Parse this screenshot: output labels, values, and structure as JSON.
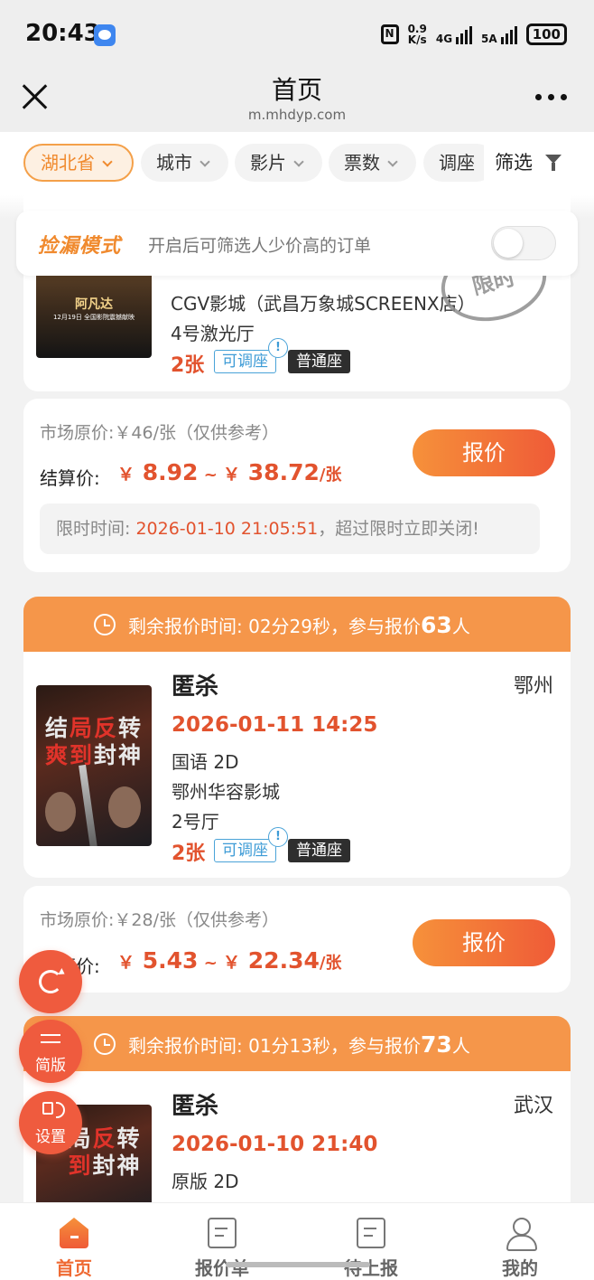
{
  "status_bar": {
    "time": "20:43",
    "nfc": "N",
    "speed_value": "0.9",
    "speed_unit": "K/s",
    "network_1": "4G",
    "network_2": "5A",
    "battery": "100"
  },
  "header": {
    "title": "首页",
    "url": "m.mhdyp.com"
  },
  "filters": {
    "chips": [
      "湖北省",
      "城市",
      "影片",
      "票数",
      "调座"
    ],
    "screen_label": "筛选"
  },
  "pickup_mode": {
    "title": "捡漏模式",
    "description": "开启后可筛选人少价高的订单",
    "enabled": false
  },
  "order_partial": {
    "cinema": "CGV影城（武昌万象城SCREENX店）",
    "hall": "4号激光厅",
    "count": "2张",
    "tag_adjustable": "可调座",
    "tag_seat": "普通座",
    "stamp": "限时",
    "poster_text": "阿凡达",
    "poster_sub": "12月19日 全国影院震撼献映",
    "market_price": "市场原价:￥46/张（仅供参考）",
    "settle_label": "结算价:",
    "price_low": "8.92",
    "price_high": "38.72",
    "currency": "￥",
    "unit": "/张",
    "quote_button": "报价",
    "limit_label": "限时时间:",
    "limit_time": "2026-01-10 21:05:51",
    "limit_note": "，超过限时立即关闭!"
  },
  "orders": [
    {
      "countdown_prefix": "剩余报价时间:",
      "countdown": "02分29秒",
      "participants_prefix": "，参与报价",
      "participants": "63",
      "participants_suffix": "人",
      "title": "匿杀",
      "city": "鄂州",
      "showtime": "2026-01-11 14:25",
      "version": "国语 2D",
      "cinema": "鄂州华容影城",
      "hall": "2号厅",
      "count": "2张",
      "tag_adjustable": "可调座",
      "tag_seat": "普通座",
      "market_price": "市场原价:￥28/张（仅供参考）",
      "settle_label": "结算价:",
      "price_low": "5.43",
      "price_high": "22.34",
      "currency": "￥",
      "unit": "/张",
      "quote_button": "报价",
      "poster_line1": [
        "结",
        "局",
        "反",
        "转"
      ],
      "poster_line2": [
        "爽",
        "到",
        "封",
        "神"
      ]
    },
    {
      "countdown_prefix": "剩余报价时间:",
      "countdown": "01分13秒",
      "participants_prefix": "，参与报价",
      "participants": "73",
      "participants_suffix": "人",
      "title": "匿杀",
      "city": "武汉",
      "showtime": "2026-01-10 21:40",
      "version": "原版 2D",
      "poster_line1": [
        "局",
        "反",
        "转"
      ],
      "poster_line2": [
        "到",
        "封",
        "神"
      ]
    }
  ],
  "floating": {
    "refresh_icon": "refresh-icon",
    "simple_label": "简版",
    "settings_label": "设置"
  },
  "bottom_nav": [
    {
      "label": "首页",
      "icon": "home-icon",
      "active": true
    },
    {
      "label": "报价单",
      "icon": "quote-list-icon",
      "active": false
    },
    {
      "label": "待上报",
      "icon": "pending-report-icon",
      "active": false
    },
    {
      "label": "我的",
      "icon": "user-icon",
      "active": false
    }
  ],
  "colors": {
    "accent": "#ef5b37",
    "accent_light": "#f5964a",
    "price_red": "#e2532e",
    "tag_blue": "#3d9bd6"
  }
}
